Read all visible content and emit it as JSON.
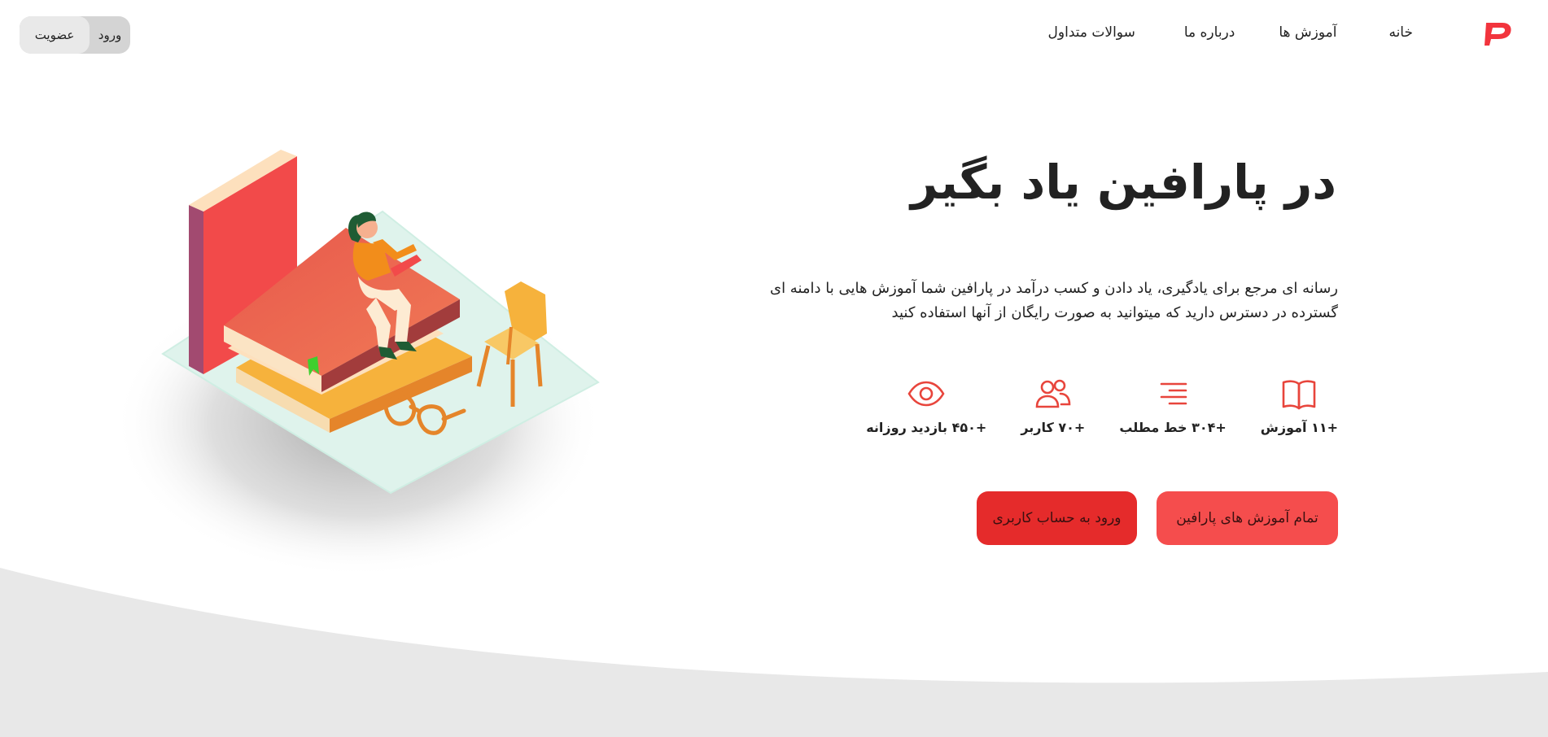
{
  "brand": {
    "logo_icon": "paraffin-logo-icon",
    "accent": "#f2343d"
  },
  "nav": {
    "items": [
      {
        "label": "خانه"
      },
      {
        "label": "آموزش ها"
      },
      {
        "label": "درباره ما"
      },
      {
        "label": "سوالات متداول"
      }
    ]
  },
  "auth": {
    "login_label": "ورود",
    "join_label": "عضویت"
  },
  "hero": {
    "title": "در پارافین  یاد بگیر",
    "description": "رسانه ای مرجع برای یادگیری، یاد دادن و کسب درآمد در پارافین شما آموزش هایی با دامنه ای گسترده در دسترس دارید که میتوانید به صورت رایگان از آنها استفاده کنید"
  },
  "stats": [
    {
      "icon": "open-book-icon",
      "label": "+۱۱ آموزش"
    },
    {
      "icon": "text-lines-icon",
      "label": "+۳۰۴ خط مطلب"
    },
    {
      "icon": "users-icon",
      "label": "+۷۰ کاربر"
    },
    {
      "icon": "eye-icon",
      "label": "+۴۵۰ بازدید روزانه"
    }
  ],
  "buttons": {
    "all_tutorials": "تمام آموزش های پارافین",
    "login_account": "ورود به حساب کاربری"
  },
  "colors": {
    "icon_red": "#e8453c",
    "button_light": "#f54d4d",
    "button_dark": "#e52b2b",
    "wave_gray": "#e8e8e8"
  },
  "illustration": {
    "name": "woman-reading-on-books-illustration"
  }
}
